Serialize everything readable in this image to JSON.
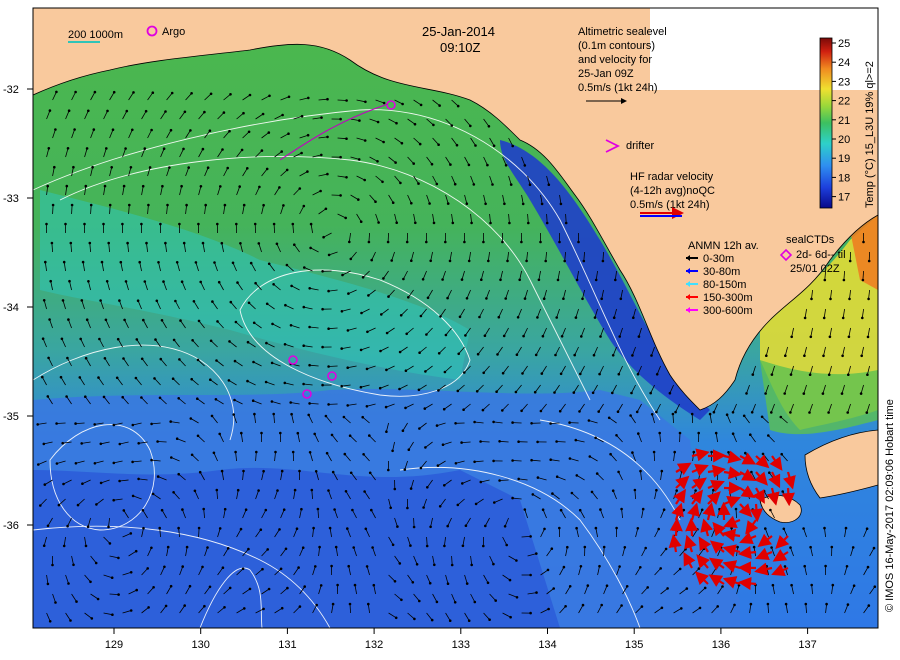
{
  "date": "25-Jan-2014",
  "time": "09:10Z",
  "depth_contours_label": "200  1000m",
  "argo_label": "Argo",
  "altimetry": {
    "lines": [
      "Altimetric sealevel",
      "(0.1m contours)",
      "and velocity for",
      "25-Jan 09Z",
      "0.5m/s (1kt 24h)"
    ]
  },
  "drifter_label": "drifter",
  "hf_radar": {
    "lines": [
      "HF radar velocity",
      "(4-12h avg)noQC",
      "0.5m/s (1kt 24h)"
    ]
  },
  "anmn": {
    "title": "ANMN 12h av.",
    "items": [
      {
        "label": "0-30m",
        "color": "#000000"
      },
      {
        "label": "30-80m",
        "color": "#0000ff"
      },
      {
        "label": "80-150m",
        "color": "#40e0ff"
      },
      {
        "label": "150-300m",
        "color": "#ff0000"
      },
      {
        "label": "300-600m",
        "color": "#ff00ff"
      }
    ]
  },
  "seal_ctds": {
    "lines": [
      "sealCTDs",
      "2d- 6d-- til",
      "25/01 02Z"
    ]
  },
  "colorbar": {
    "title": "Temp (°C) 15_L3U 19% ql>=2",
    "ticks": [
      "25",
      "24",
      "23",
      "22",
      "21",
      "20",
      "19",
      "18",
      "17"
    ]
  },
  "credit": "© IMOS 16-May-2017 02:09:06 Hobart time",
  "x_ticks": [
    "129",
    "130",
    "131",
    "132",
    "133",
    "134",
    "135",
    "136",
    "137"
  ],
  "y_ticks": [
    "-32",
    "-33",
    "-34",
    "-35",
    "-36"
  ],
  "colors": {
    "land": "#f9c99d",
    "deep_blue": "#1f3fc9",
    "mid_blue": "#3a7fe8",
    "cyan": "#2fc7c0",
    "green": "#49b84b",
    "yellow": "#e6e03c",
    "arrow": "#000000",
    "radar": "#e00000",
    "contour": "#ffffff"
  }
}
